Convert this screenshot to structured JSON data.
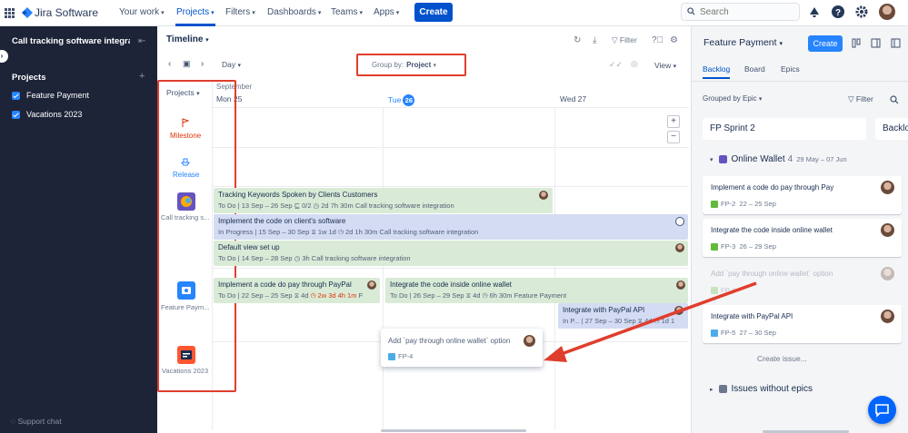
{
  "topnav": {
    "logo": "Jira Software",
    "items": [
      {
        "label": "Your work"
      },
      {
        "label": "Projects"
      },
      {
        "label": "Filters"
      },
      {
        "label": "Dashboards"
      },
      {
        "label": "Teams"
      },
      {
        "label": "Apps"
      }
    ],
    "create_label": "Create",
    "search_placeholder": "Search"
  },
  "sidebar": {
    "project_name": "Call tracking software integra...",
    "heading": "Projects",
    "items": [
      {
        "label": "Feature Payment"
      },
      {
        "label": "Vacations 2023"
      }
    ],
    "support": "Support chat"
  },
  "timeline": {
    "title": "Timeline",
    "filter_label": "Filter",
    "day_label": "Day",
    "group_by_label": "Group by:",
    "group_by_value": "Project",
    "view_label": "View",
    "projects_label": "Projects",
    "month": "September",
    "days": [
      {
        "label": "Mon 25"
      },
      {
        "label": "Tue",
        "num": "26"
      },
      {
        "label": "Wed 27"
      }
    ],
    "milestone_label": "Milestone",
    "release_label": "Release",
    "projects": [
      {
        "name": "Call tracking s..."
      },
      {
        "name": "Feature Paym..."
      },
      {
        "name": "Vacations 2023"
      }
    ],
    "bars": [
      {
        "title": "Tracking Keywords Spoken by Clients Customers",
        "status": "To Do",
        "dates": "13 Sep – 26 Sep",
        "children": "0/2",
        "time": "2d 7h 30m",
        "project": "Call tracking software integration"
      },
      {
        "title": "Implement the code on client's software",
        "status": "In Progress",
        "dates": "15 Sep – 30 Sep",
        "estimate": "1w 1d",
        "time": "2d 1h 30m",
        "project": "Call tracking software integration"
      },
      {
        "title": "Default view set up",
        "status": "To Do",
        "dates": "14 Sep – 28 Sep",
        "time": "3h",
        "project": "Call tracking software integration"
      },
      {
        "title": "Implement a code do pay through PayPal",
        "status": "To Do",
        "dates": "22 Sep – 25 Sep",
        "estimate": "4d",
        "time": "2w 3d 4h 1m",
        "project": "F"
      },
      {
        "title": "Integrate the code inside online wallet",
        "status": "To Do",
        "dates": "26 Sep – 29 Sep",
        "estimate": "4d",
        "time": "6h 30m",
        "project": "Feature Payment"
      },
      {
        "title": "Integrate with PayPal API",
        "status": "In P...",
        "dates": "27 Sep – 30 Sep",
        "estimate": "4d",
        "time": "1d 1"
      }
    ],
    "drag_card": {
      "title": "Add `pay through online wallet` option",
      "key": "FP-4"
    }
  },
  "panel": {
    "title": "Feature Payment",
    "create_label": "Create",
    "tabs": [
      {
        "label": "Backlog"
      },
      {
        "label": "Board"
      },
      {
        "label": "Epics"
      }
    ],
    "grouped_by": "Grouped by Epic",
    "filter_label": "Filter",
    "sprint_name": "FP Sprint 2",
    "backlog_label": "Backlo",
    "epic": {
      "name": "Online Wallet",
      "count": "4",
      "dates": "29 May – 07 Jun"
    },
    "cards": [
      {
        "title": "Implement a code do pay through Pay",
        "key": "FP-2",
        "dates": "22 – 25 Sep",
        "ghost": false
      },
      {
        "title": "Integrate the code inside online wallet",
        "key": "FP-3",
        "dates": "26 – 29 Sep",
        "ghost": false
      },
      {
        "title": "Add `pay through online wallet` option",
        "key": "FP-4",
        "dates": "",
        "ghost": true
      },
      {
        "title": "Integrate with PayPal API",
        "key": "FP-5",
        "dates": "27 – 30 Sep",
        "ghost": false
      }
    ],
    "create_issue": "Create issue...",
    "no_epics": "Issues without epics"
  },
  "colors": {
    "accent": "#0052cc",
    "sidebar_bg": "#1d2438",
    "todo_bar": "#d9ebd6",
    "progress_bar": "#d4dcf3",
    "annotation_red": "#e03e2d"
  }
}
